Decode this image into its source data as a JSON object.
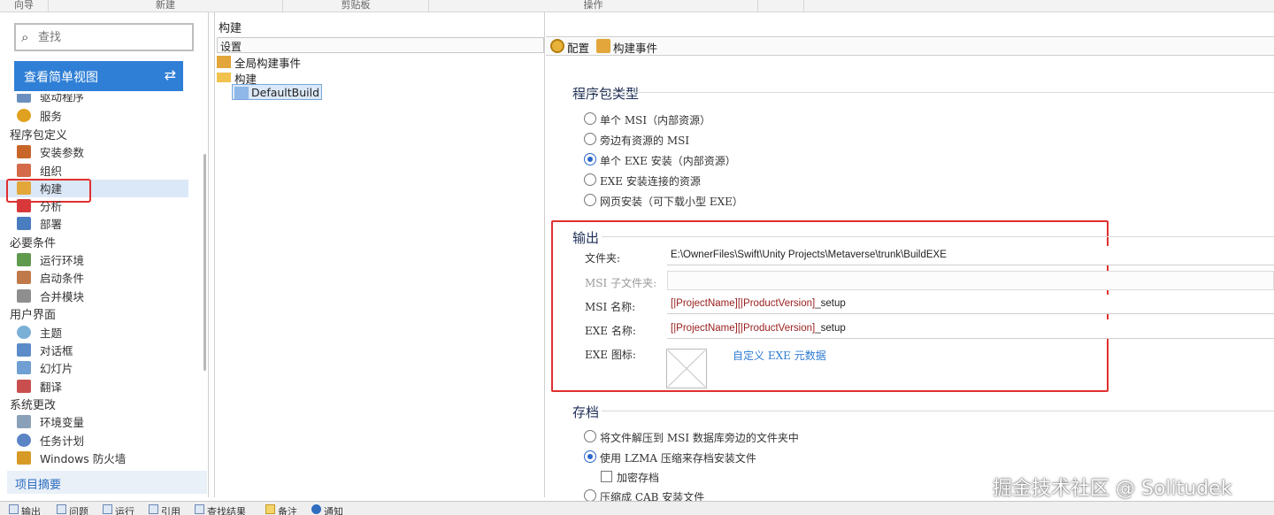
{
  "ribbon": {
    "groups": [
      "向导",
      "新建",
      "剪贴板",
      "操作"
    ]
  },
  "sidebar": {
    "search_placeholder": "查找",
    "simple_view_label": "查看简单视图",
    "items": {
      "drivers": "驱动程序",
      "services": "服务",
      "cat_package": "程序包定义",
      "install_params": "安装参数",
      "organization": "组织",
      "build": "构建",
      "analysis": "分析",
      "deploy": "部署",
      "cat_prereq": "必要条件",
      "runtime": "运行环境",
      "launch_conditions": "启动条件",
      "merge_modules": "合并模块",
      "cat_ui": "用户界面",
      "theme": "主题",
      "dialogs": "对话框",
      "slideshow": "幻灯片",
      "translation": "翻译",
      "cat_system": "系统更改",
      "env_vars": "环境变量",
      "tasks": "任务计划",
      "firewall": "Windows 防火墙"
    },
    "project_summary": "项目摘要"
  },
  "center": {
    "title": "构建",
    "header": "设置",
    "tree": {
      "global_events": "全局构建事件",
      "build_folder": "构建",
      "default_build": "DefaultBuild"
    }
  },
  "right": {
    "tabs": {
      "config": "配置",
      "build_events": "构建事件"
    },
    "package_type": {
      "title": "程序包类型",
      "options": [
        "单个 MSI（内部资源）",
        "旁边有资源的 MSI",
        "单个 EXE 安装（内部资源）",
        "EXE 安装连接的资源",
        "网页安装（可下载小型 EXE）"
      ],
      "selected": 2
    },
    "output": {
      "title": "输出",
      "folder_label": "文件夹:",
      "folder_value": "E:\\OwnerFiles\\Swift\\Unity Projects\\Metaverse\\trunk\\BuildEXE",
      "msi_subfolder_label": "MSI 子文件夹:",
      "msi_name_label": "MSI 名称:",
      "msi_name_tok1": "[|ProjectName]",
      "msi_name_tok2": "[|ProductVersion]",
      "msi_name_suffix": "_setup",
      "exe_name_label": "EXE 名称:",
      "exe_name_tok1": "[|ProjectName]",
      "exe_name_tok2": "[|ProductVersion]",
      "exe_name_suffix": "_setup",
      "exe_icon_label": "EXE 图标:",
      "custom_meta_link": "自定义 EXE 元数据"
    },
    "archive": {
      "title": "存档",
      "opt1": "将文件解压到 MSI 数据库旁边的文件夹中",
      "opt2": "使用 LZMA 压缩来存档安装文件",
      "encrypt": "加密存档",
      "opt3": "压缩成 CAB 安装文件"
    }
  },
  "bottom_tabs": [
    "输出",
    "问题",
    "运行",
    "引用",
    "查找结果",
    "备注",
    "通知"
  ],
  "watermark": "掘金技术社区 @ Solitudek"
}
